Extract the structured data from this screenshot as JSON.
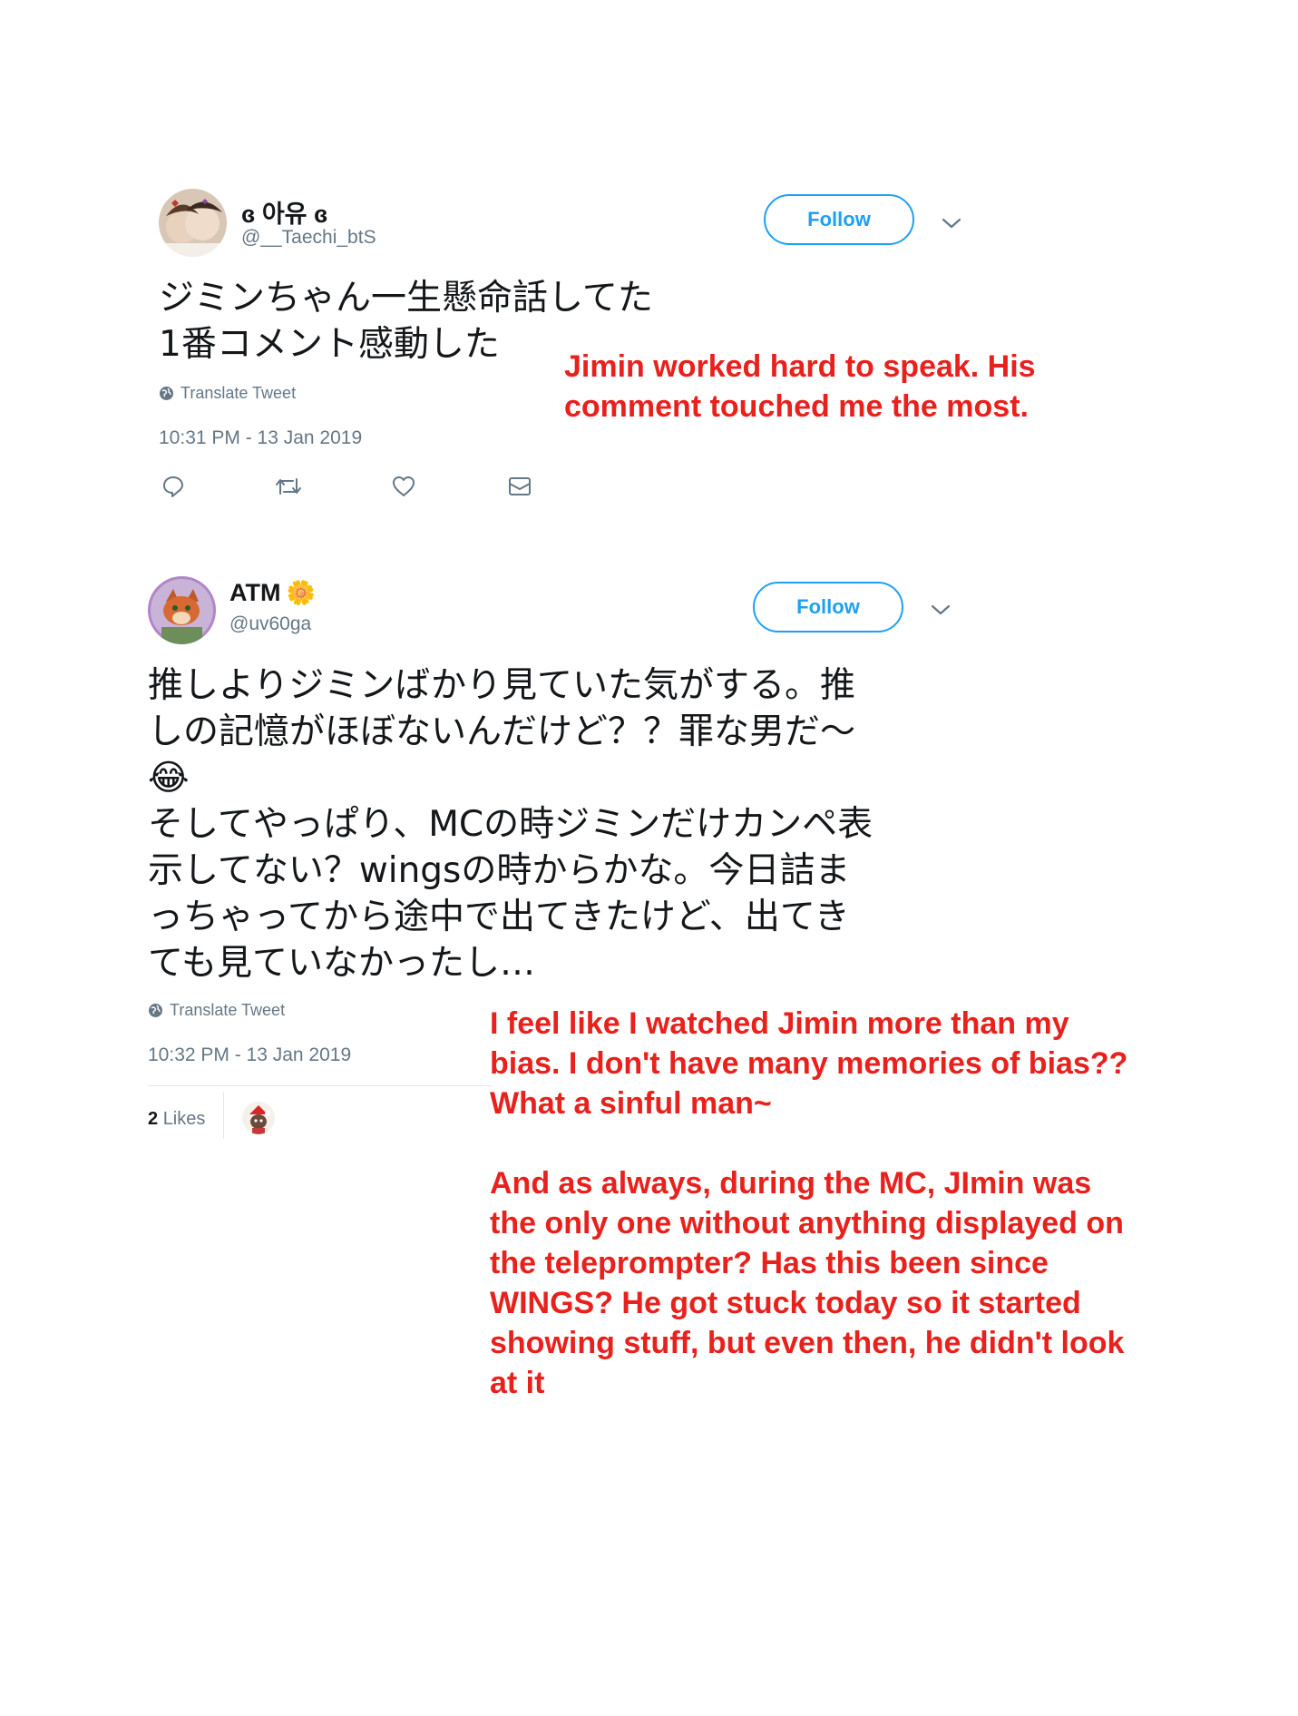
{
  "tweet1": {
    "display_name": "ɞ 아유 ɞ",
    "handle": "@__Taechi_btS",
    "follow_label": "Follow",
    "text": "ジミンちゃん一生懸命話してた\n1番コメント感動した",
    "translate_label": "Translate Tweet",
    "timestamp": "10:31 PM - 13 Jan 2019",
    "icons": [
      "reply-icon",
      "retweet-icon",
      "like-icon",
      "dm-icon"
    ]
  },
  "annotation1": "Jimin worked hard to speak. His\ncomment touched me the most.",
  "tweet2": {
    "display_name": "ATM",
    "name_emoji": "🌼",
    "handle": "@uv60ga",
    "follow_label": "Follow",
    "text": "推しよりジミンばかり見ていた気がする。推\nしの記憶がほぼないんだけど？？罪な男だ〜\n😂\nそしてやっぱり、MCの時ジミンだけカンペ表\n示してない？wingsの時からかな。今日詰ま\nっちゃってから途中で出てきたけど、出てき\nても見ていなかったし…",
    "translate_label": "Translate Tweet",
    "timestamp": "10:32 PM - 13 Jan 2019",
    "likes_count": "2",
    "likes_label": "Likes"
  },
  "annotation2": "I feel like I watched Jimin more than my\nbias. I don't have many memories of bias??\nWhat a sinful man~\n\nAnd as always, during the MC, JImin was\nthe only one without anything displayed on\nthe teleprompter? Has this been since\nWINGS? He got stuck today so it started\nshowing stuff, but even then, he didn't look\nat it",
  "colors": {
    "twitter_blue": "#1da1f2",
    "secondary_text": "#657786",
    "annotation_red": "#e8211d"
  }
}
